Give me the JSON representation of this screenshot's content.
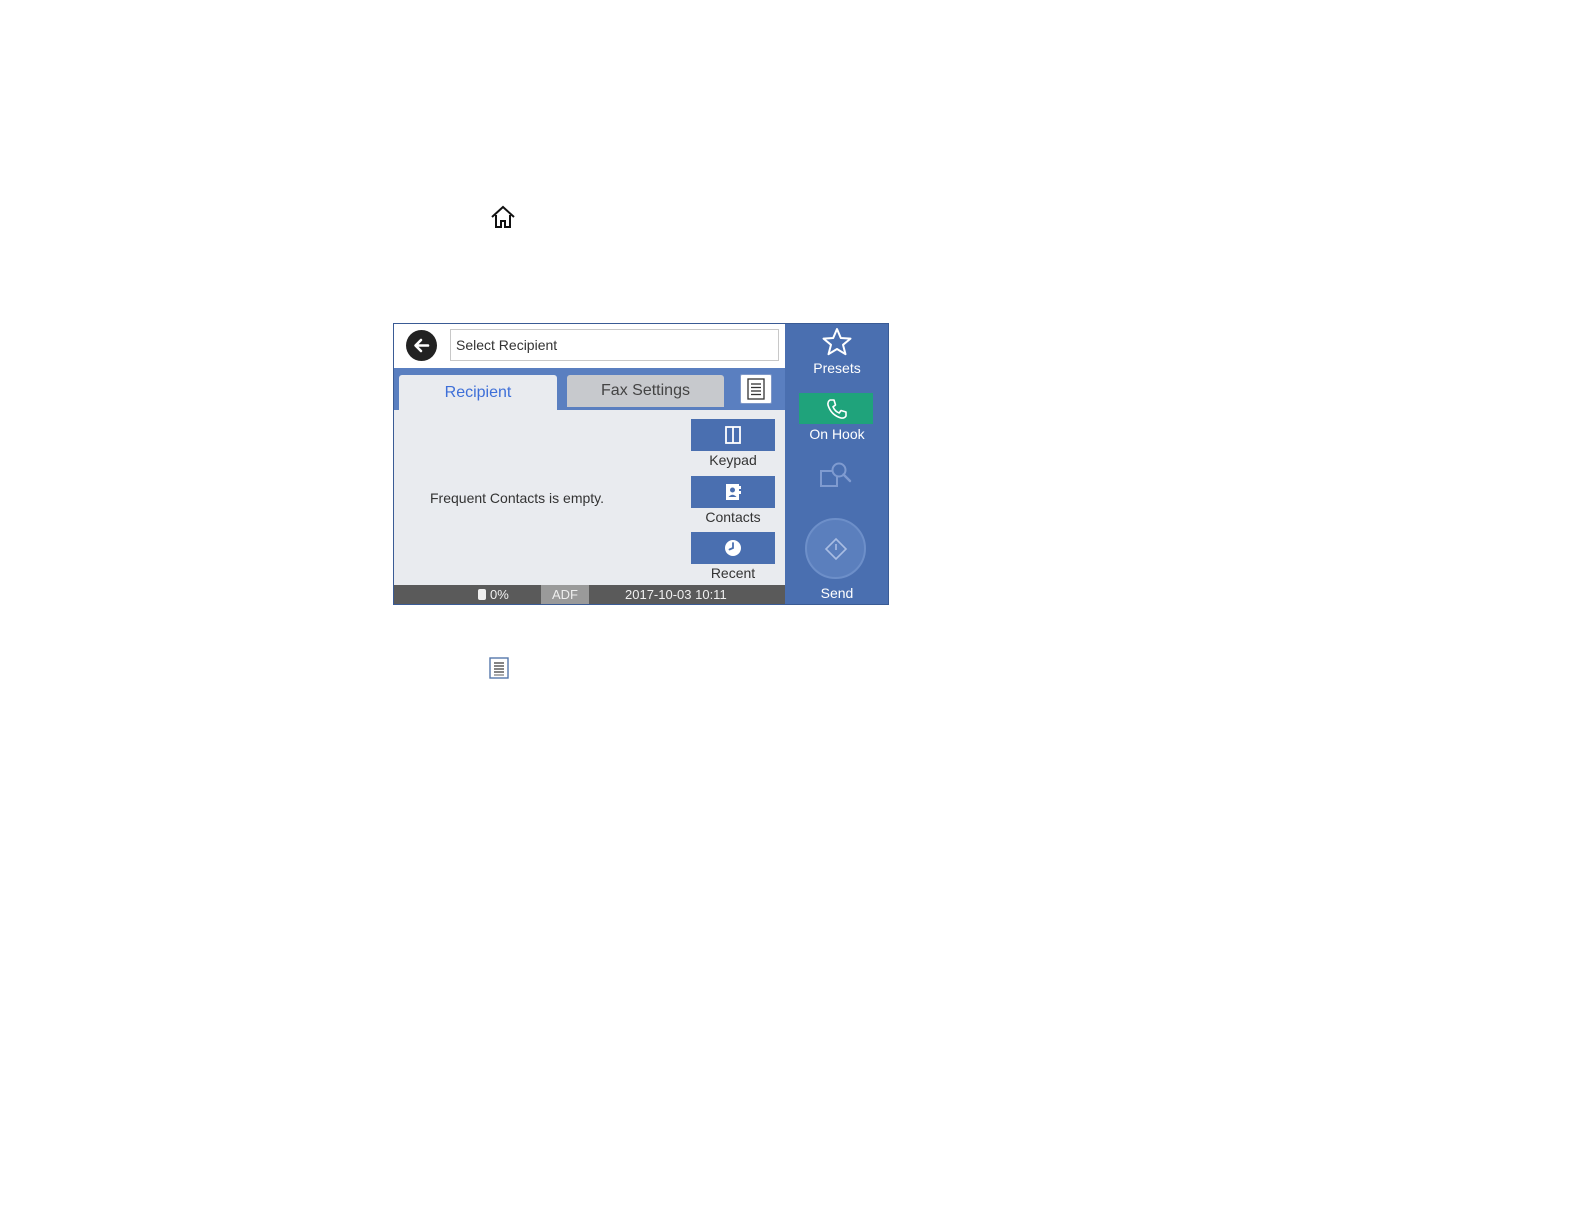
{
  "doc_icons": {
    "home": "home-icon",
    "menu": "menu-icon"
  },
  "panel": {
    "field": {
      "placeholder": "Select Recipient"
    },
    "tabs": [
      {
        "label": "Recipient",
        "active": true
      },
      {
        "label": "Fax Settings",
        "active": false
      }
    ],
    "empty_message": "Frequent Contacts is empty.",
    "side_buttons": [
      {
        "label": "Keypad",
        "icon": "keypad-icon"
      },
      {
        "label": "Contacts",
        "icon": "contacts-icon"
      },
      {
        "label": "Recent",
        "icon": "recent-clock-icon"
      }
    ],
    "status": {
      "ink_level": "0%",
      "source": "ADF",
      "datetime": "2017-10-03 10:11"
    },
    "right": {
      "presets_label": "Presets",
      "onhook_label": "On Hook",
      "send_label": "Send"
    },
    "colors": {
      "panel_blue": "#4a6fb0",
      "tab_active_text": "#3e6fd8",
      "onhook_green": "#1fa37b",
      "status_bar": "#5a5a5a"
    }
  }
}
